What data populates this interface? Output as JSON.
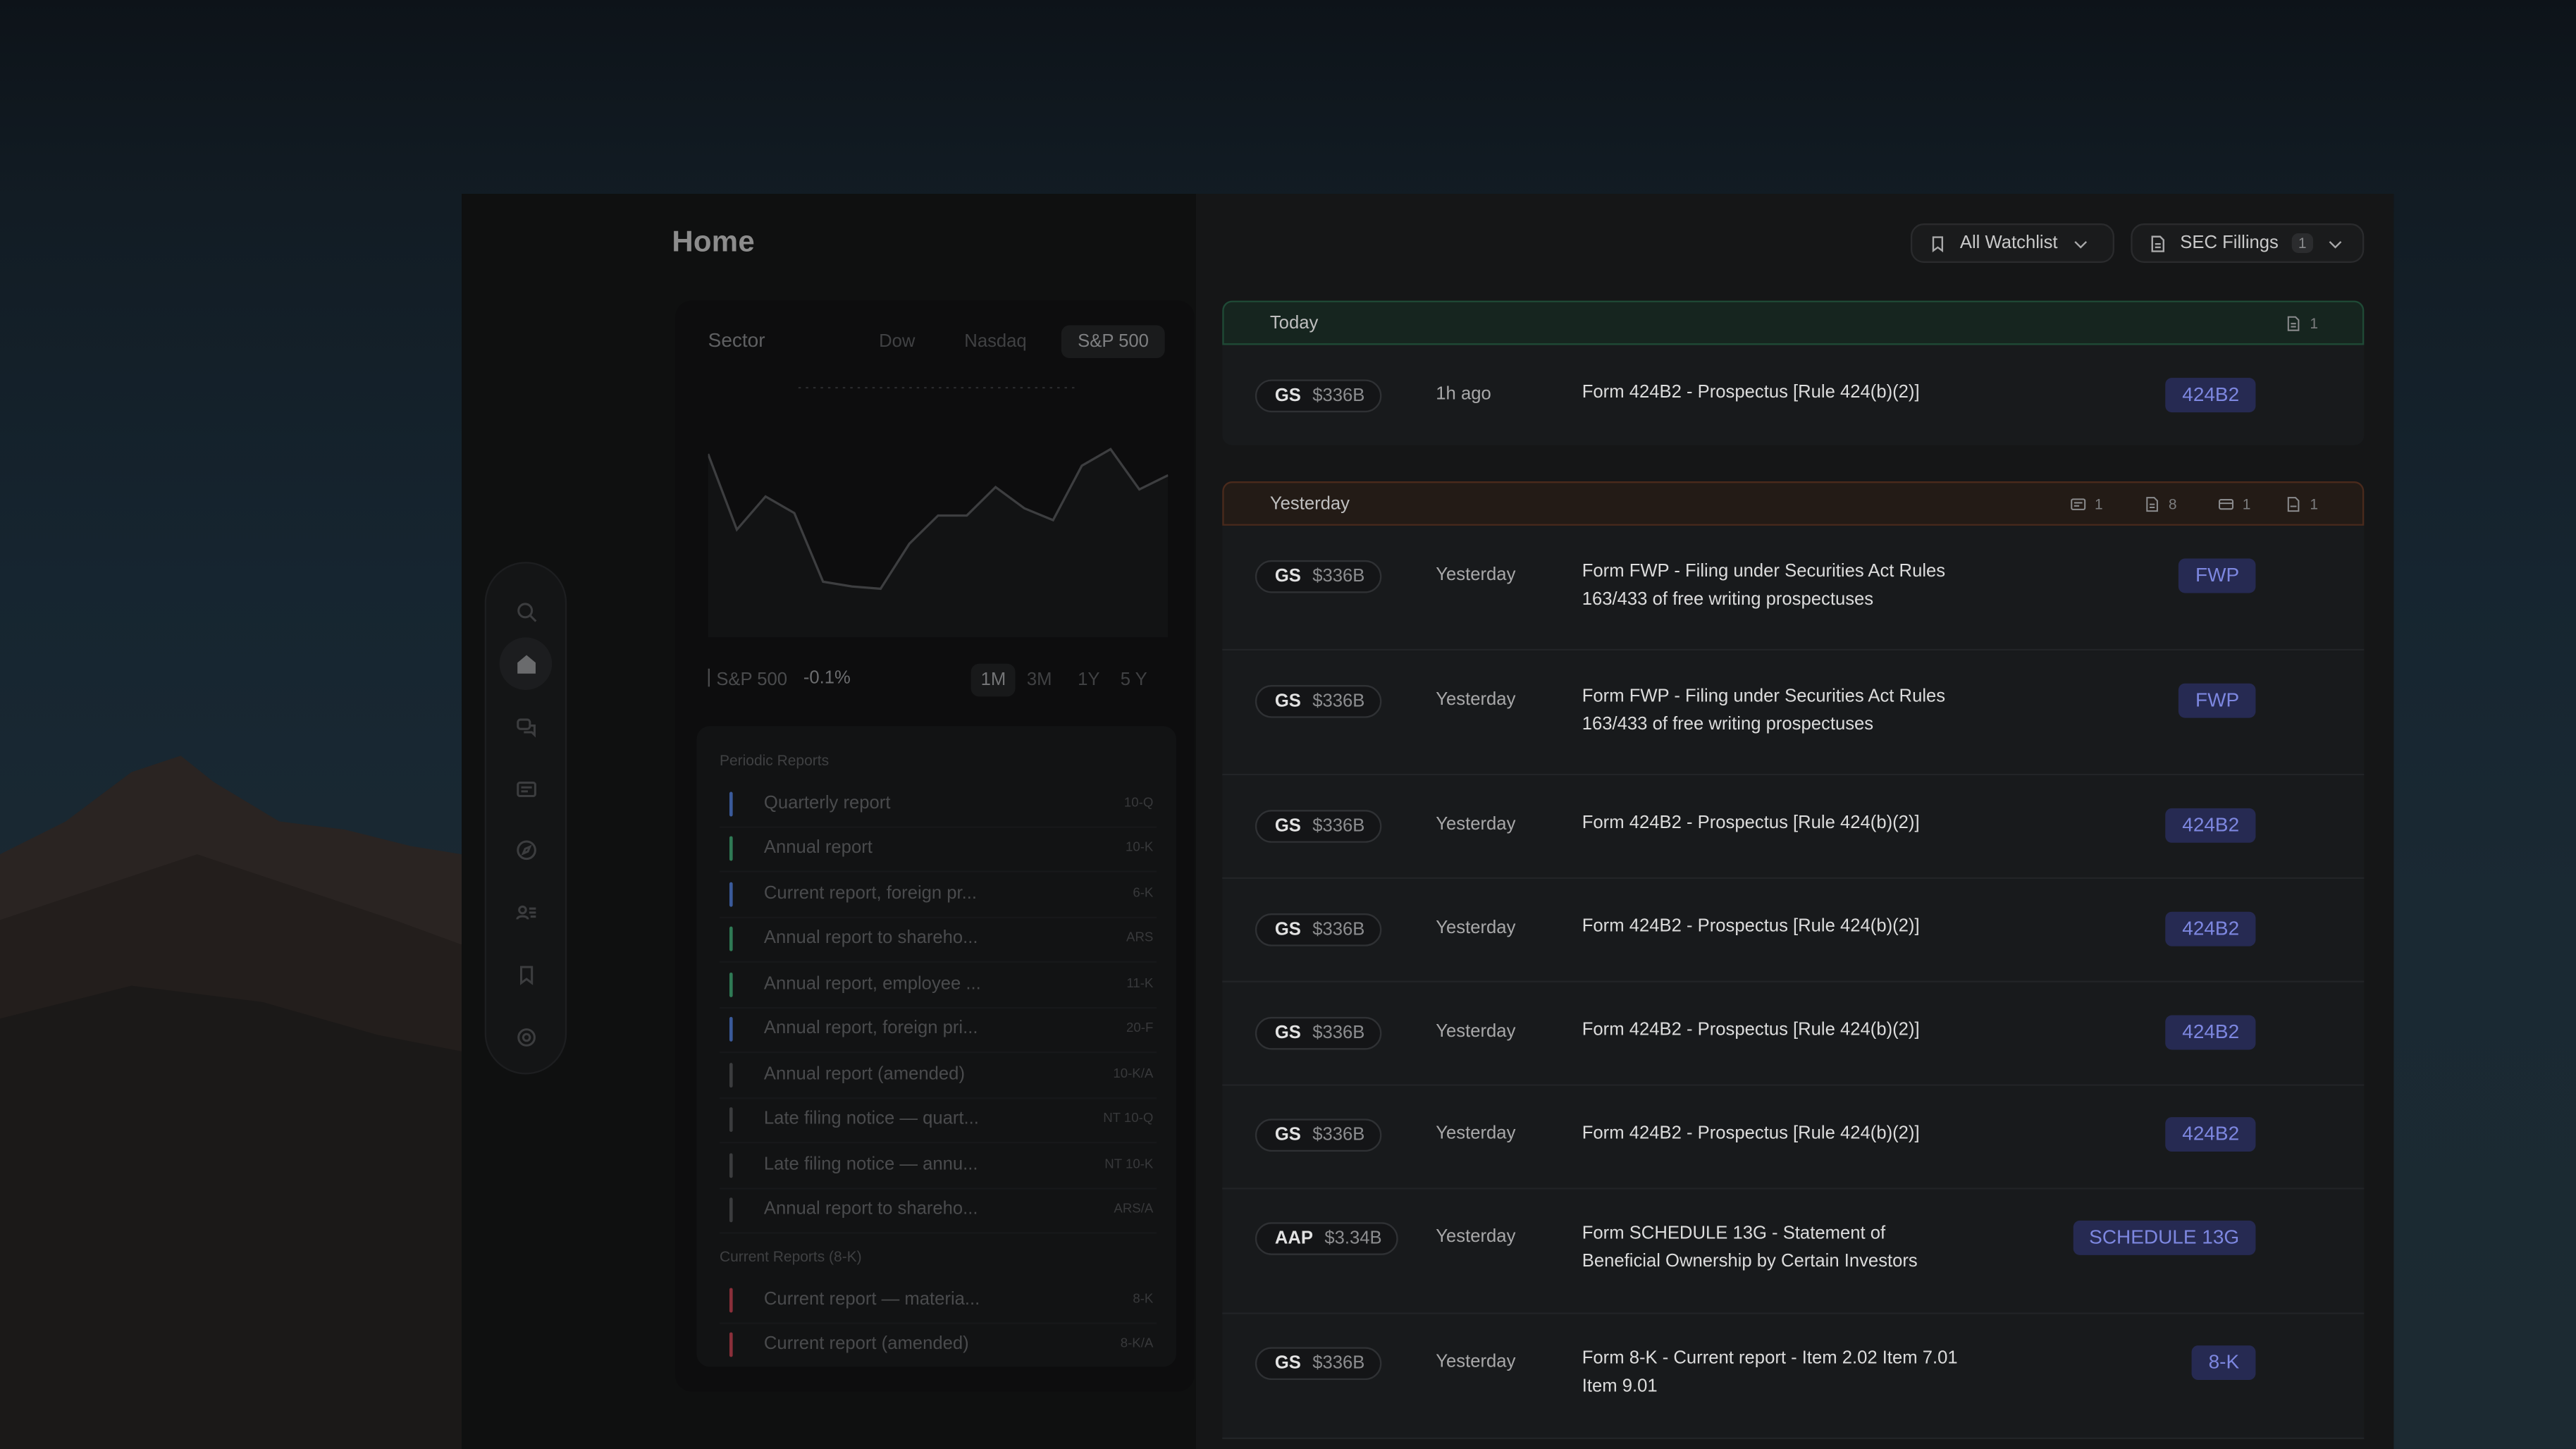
{
  "page": {
    "title": "Home"
  },
  "sidebar": {
    "items": [
      {
        "icon": "search-icon"
      },
      {
        "icon": "home-icon",
        "active": true
      },
      {
        "icon": "chat-icon"
      },
      {
        "icon": "news-icon"
      },
      {
        "icon": "compass-icon"
      },
      {
        "icon": "contacts-icon"
      },
      {
        "icon": "bookmark-icon"
      },
      {
        "icon": "settings-icon"
      }
    ]
  },
  "sector": {
    "label": "Sector",
    "tabs": [
      "Dow",
      "Nasdaq",
      "S&P 500"
    ],
    "active_tab": "S&P 500",
    "index_name": "S&P 500",
    "change": "-0.1%",
    "ranges": [
      "1M",
      "3M",
      "1Y",
      "5 Y"
    ],
    "active_range": "1M"
  },
  "chart_data": {
    "type": "line",
    "series": [
      {
        "values": [
          72,
          40,
          54,
          47,
          18,
          16,
          15,
          34,
          46,
          46,
          58,
          49,
          44,
          67,
          74,
          57,
          63
        ]
      }
    ],
    "ylim": [
      0,
      100
    ],
    "grid": false
  },
  "reports": {
    "groups": [
      {
        "title": "Periodic Reports",
        "items": [
          {
            "name": "Quarterly report",
            "code": "10-Q",
            "color": "#3a5a9a"
          },
          {
            "name": "Annual report",
            "code": "10-K",
            "color": "#2f7a55"
          },
          {
            "name": "Current report, foreign pr...",
            "code": "6-K",
            "color": "#3a5a9a"
          },
          {
            "name": "Annual report to shareho...",
            "code": "ARS",
            "color": "#2f7a55"
          },
          {
            "name": "Annual report, employee ...",
            "code": "11-K",
            "color": "#2f7a55"
          },
          {
            "name": "Annual report, foreign pri...",
            "code": "20-F",
            "color": "#3a5a9a"
          },
          {
            "name": "Annual report (amended)",
            "code": "10-K/A",
            "color": "#3b3c3e"
          },
          {
            "name": "Late filing notice — quart...",
            "code": "NT 10-Q",
            "color": "#3b3c3e"
          },
          {
            "name": "Late filing notice — annu...",
            "code": "NT 10-K",
            "color": "#3b3c3e"
          },
          {
            "name": "Annual report to shareho...",
            "code": "ARS/A",
            "color": "#3b3c3e"
          }
        ]
      },
      {
        "title": "Current Reports (8-K)",
        "items": [
          {
            "name": "Current report — materia...",
            "code": "8-K",
            "color": "#8a2f3a"
          },
          {
            "name": "Current report (amended)",
            "code": "8-K/A",
            "color": "#8a2f3a"
          }
        ]
      }
    ]
  },
  "controls": {
    "watchlist_label": "All Watchlist",
    "filings_label": "SEC Fillings",
    "filings_count": "1"
  },
  "feed": {
    "today": {
      "label": "Today",
      "counts": [
        {
          "icon": "document-icon",
          "count": "1"
        }
      ]
    },
    "yesterday": {
      "label": "Yesterday",
      "counts": [
        {
          "icon": "news-icon",
          "count": "1"
        },
        {
          "icon": "document-icon",
          "count": "8"
        },
        {
          "icon": "card-icon",
          "count": "1"
        },
        {
          "icon": "pdf-document-icon",
          "count": "1"
        }
      ]
    },
    "rows": [
      {
        "ticker": "GS",
        "cap": "$336B",
        "time": "1h ago",
        "desc": "Form 424B2 - Prospectus [Rule 424(b)(2)]",
        "badge": "424B2"
      },
      {
        "ticker": "GS",
        "cap": "$336B",
        "time": "Yesterday",
        "desc": "Form FWP - Filing under Securities Act Rules 163/433 of free writing prospectuses",
        "badge": "FWP"
      },
      {
        "ticker": "GS",
        "cap": "$336B",
        "time": "Yesterday",
        "desc": "Form FWP - Filing under Securities Act Rules 163/433 of free writing prospectuses",
        "badge": "FWP"
      },
      {
        "ticker": "GS",
        "cap": "$336B",
        "time": "Yesterday",
        "desc": "Form 424B2 - Prospectus [Rule 424(b)(2)]",
        "badge": "424B2"
      },
      {
        "ticker": "GS",
        "cap": "$336B",
        "time": "Yesterday",
        "desc": "Form 424B2 - Prospectus [Rule 424(b)(2)]",
        "badge": "424B2"
      },
      {
        "ticker": "GS",
        "cap": "$336B",
        "time": "Yesterday",
        "desc": "Form 424B2 - Prospectus [Rule 424(b)(2)]",
        "badge": "424B2"
      },
      {
        "ticker": "GS",
        "cap": "$336B",
        "time": "Yesterday",
        "desc": "Form 424B2 - Prospectus [Rule 424(b)(2)]",
        "badge": "424B2"
      },
      {
        "ticker": "AAP",
        "cap": "$3.34B",
        "time": "Yesterday",
        "desc": "Form SCHEDULE 13G - Statement of Beneficial Ownership by Certain Investors",
        "badge": "SCHEDULE 13G"
      },
      {
        "ticker": "GS",
        "cap": "$336B",
        "time": "Yesterday",
        "desc": "Form 8-K - Current report - Item 2.02 Item 7.01 Item 9.01",
        "badge": "8-K"
      }
    ]
  }
}
